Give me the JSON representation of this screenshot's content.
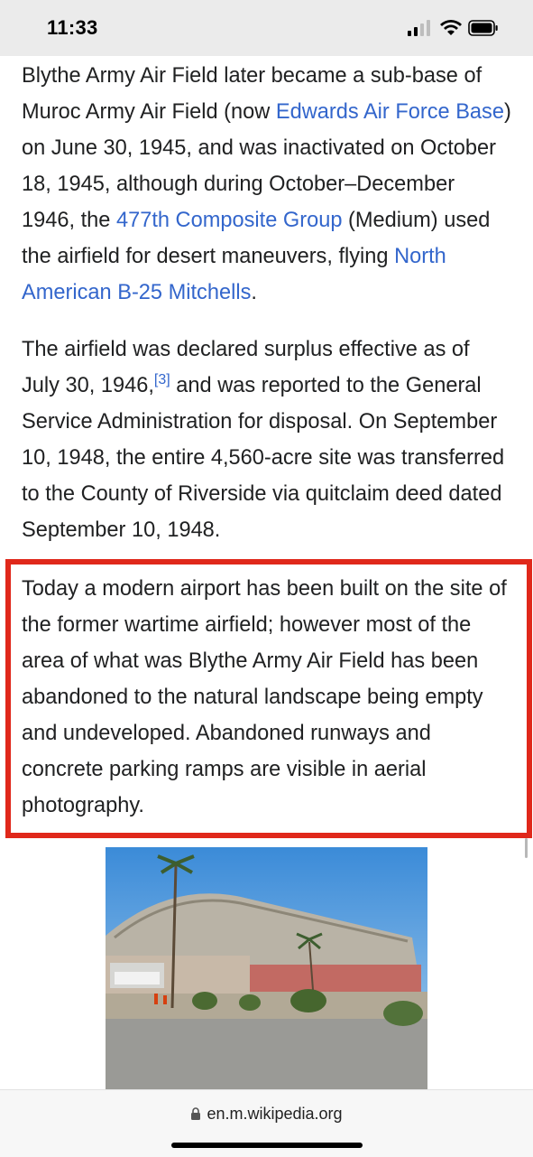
{
  "status_bar": {
    "time": "11:33",
    "icons": [
      "signal-icon",
      "wifi-icon",
      "battery-icon"
    ]
  },
  "article": {
    "p1": {
      "t1": "Blythe Army Air Field later became a sub-base of Muroc Army Air Field (now ",
      "link1": "Edwards Air Force Base",
      "t2": ") on June 30, 1945, and was inactivated on October 18, 1945, although during October–December 1946, the ",
      "link2": "477th Composite Group",
      "t3": " (Medium) used the airfield for desert maneuvers, flying ",
      "link3": "North American B-25 Mitchells",
      "t4": "."
    },
    "p2": {
      "t1": "The airfield was declared surplus effective as of July 30, 1946,",
      "ref": "[3]",
      "t2": " and was reported to the General Service Administration for disposal. On September 10, 1948, the entire 4,560-acre site was transferred to the County of Riverside via quitclaim deed dated September 10, 1948."
    },
    "p3": {
      "text": "Today a modern airport has been built on the site of the former wartime airfield; however most of the area of what was Blythe Army Air Field has been abandoned to the natural landscape being empty and undeveloped. Abandoned runways and concrete parking ramps are visible in aerial photography."
    }
  },
  "colors": {
    "link": "#3366cc",
    "highlight": "#e0281b",
    "text": "#202122"
  },
  "bottom_bar": {
    "url": "en.m.wikipedia.org",
    "icon": "lock-icon"
  }
}
